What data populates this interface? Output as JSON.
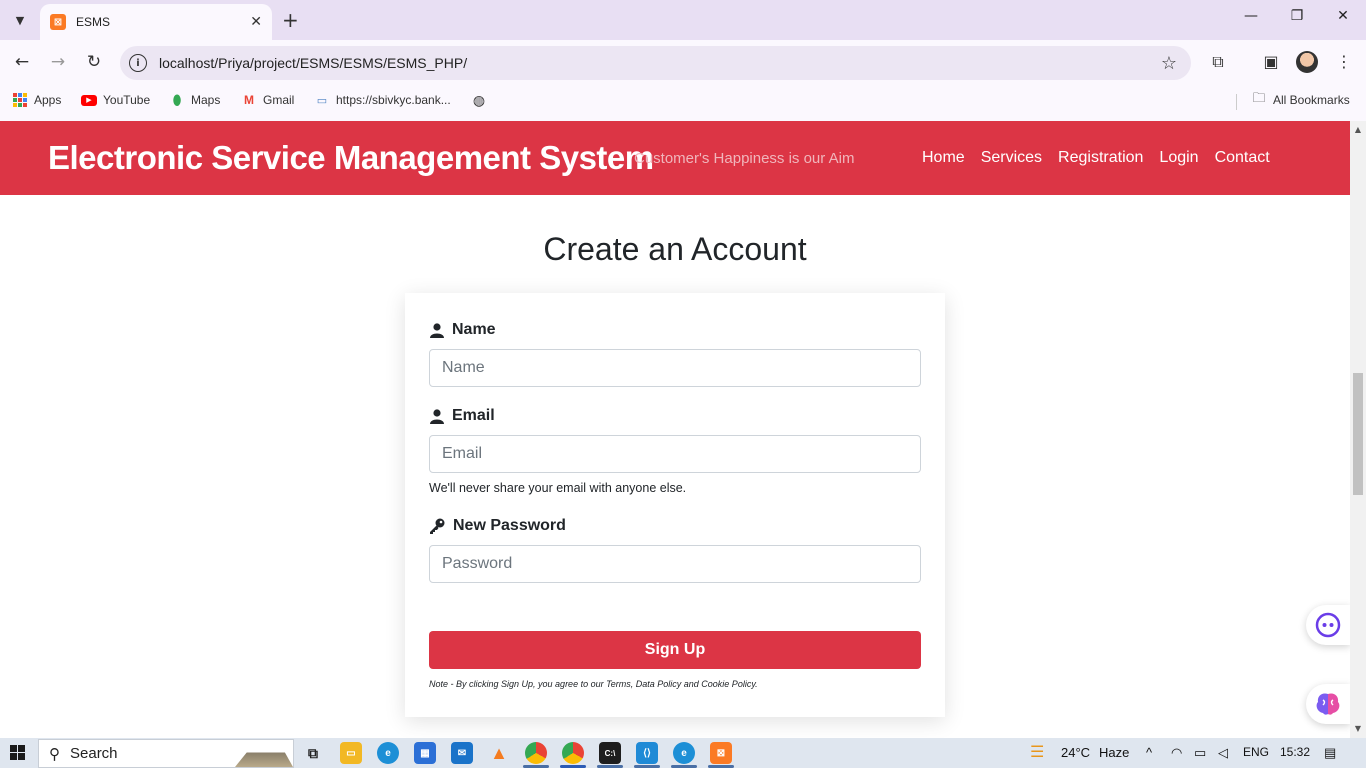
{
  "browser": {
    "tab_title": "ESMS",
    "tab_favicon": "xampp-icon",
    "url": "localhost/Priya/project/ESMS/ESMS/ESMS_PHP/",
    "bookmarks": [
      {
        "label": "Apps",
        "icon": "apps-grid-icon"
      },
      {
        "label": "YouTube",
        "icon": "youtube-icon"
      },
      {
        "label": "Maps",
        "icon": "maps-pin-icon"
      },
      {
        "label": "Gmail",
        "icon": "gmail-icon"
      },
      {
        "label": "https://sbivkyc.bank...",
        "icon": "bank-card-icon"
      }
    ],
    "all_bookmarks_label": "All Bookmarks"
  },
  "site": {
    "brand": "Electronic Service Management System",
    "tagline": "Customer's Happiness is our Aim",
    "nav": [
      "Home",
      "Services",
      "Registration",
      "Login",
      "Contact"
    ],
    "accent_color": "#dc3545"
  },
  "form": {
    "title": "Create an Account",
    "name_label": "Name",
    "name_placeholder": "Name",
    "email_label": "Email",
    "email_placeholder": "Email",
    "email_help": "We'll never share your email with anyone else.",
    "password_label": "New Password",
    "password_placeholder": "Password",
    "submit_label": "Sign Up",
    "note": "Note - By clicking Sign Up, you agree to our Terms, Data Policy and Cookie Policy."
  },
  "taskbar": {
    "search_label": "Search",
    "temperature": "24°C",
    "weather": "Haze",
    "language": "ENG",
    "time": "15:32"
  }
}
